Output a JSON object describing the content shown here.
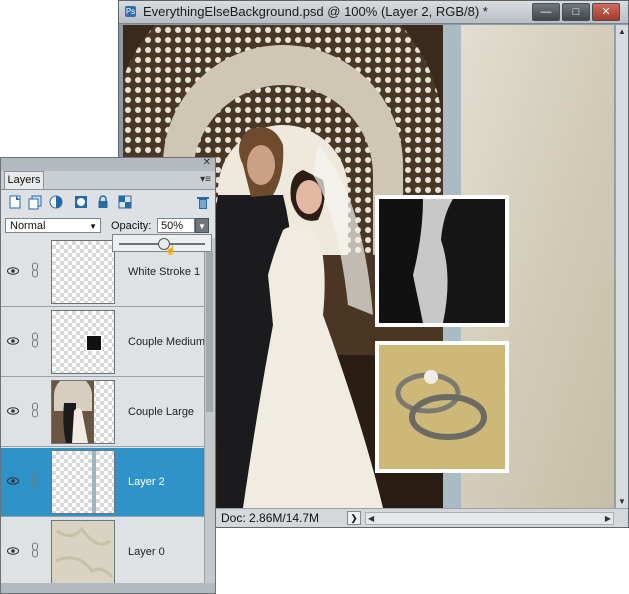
{
  "document": {
    "title": "EverythingElseBackground.psd @ 100% (Layer 2, RGB/8) *",
    "window_buttons": {
      "minimize": "—",
      "maximize": "□",
      "close": "✕"
    },
    "status": "Doc: 2.86M/14.7M",
    "status_arrow": "❯"
  },
  "layers_panel": {
    "tab": "Layers",
    "blend_mode": "Normal",
    "opacity_label": "Opacity:",
    "opacity_value": "50%",
    "opacity_slider_fraction": 0.5,
    "tool_icons": [
      "new-layer-icon",
      "new-group-icon",
      "adjustment-layer-icon",
      "layer-mask-icon",
      "lock-all-icon",
      "lock-transparent-icon",
      "trash-icon"
    ],
    "layers": [
      {
        "name": "White Stroke 1",
        "selected": false,
        "thumb": "transparent"
      },
      {
        "name": "Couple Medium",
        "selected": false,
        "thumb": "small-photo"
      },
      {
        "name": "Couple Large",
        "selected": false,
        "thumb": "couple-photo"
      },
      {
        "name": "Layer 2",
        "selected": true,
        "thumb": "frame"
      },
      {
        "name": "Layer 0",
        "selected": false,
        "thumb": "parchment"
      }
    ]
  },
  "colors": {
    "selection": "#2e93c9",
    "panel_bg": "#dfe2e5"
  }
}
